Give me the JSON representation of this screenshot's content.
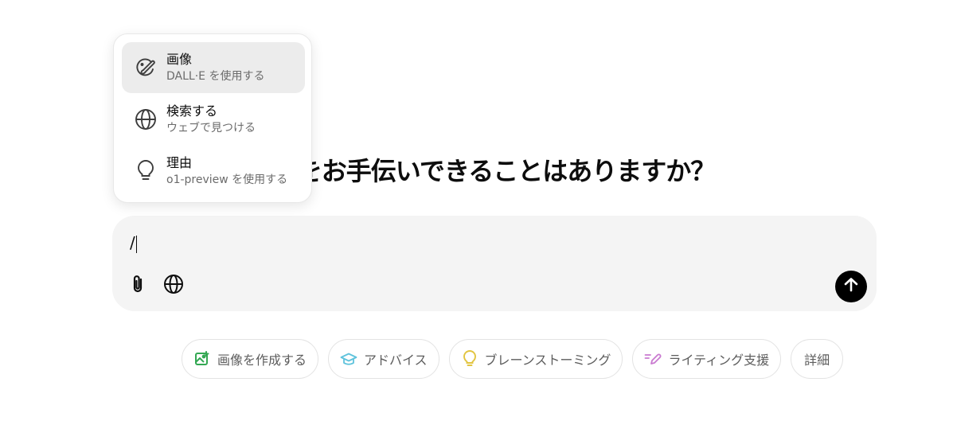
{
  "heading": "何をお手伝いできることはありますか？",
  "composer": {
    "input_value": "/",
    "attach_icon": "paperclip-icon",
    "search_icon": "globe-icon",
    "send_icon": "arrow-up-icon"
  },
  "menu": {
    "items": [
      {
        "title": "画像",
        "subtitle": "DALL·E を使用する",
        "icon": "paint-brush-icon",
        "active": true
      },
      {
        "title": "検索する",
        "subtitle": "ウェブで見つける",
        "icon": "globe-icon",
        "active": false
      },
      {
        "title": "理由",
        "subtitle": "o1-preview を使用する",
        "icon": "lightbulb-icon",
        "active": false
      }
    ]
  },
  "chips": [
    {
      "label": "画像を作成する",
      "icon": "image-icon",
      "color": "#34a853"
    },
    {
      "label": "アドバイス",
      "icon": "graduation-cap-icon",
      "color": "#5fc3dc"
    },
    {
      "label": "ブレーンストーミング",
      "icon": "lightbulb-icon",
      "color": "#e2c541"
    },
    {
      "label": "ライティング支援",
      "icon": "pen-icon",
      "color": "#c97ad0"
    },
    {
      "label": "詳細",
      "icon": "",
      "color": ""
    }
  ]
}
